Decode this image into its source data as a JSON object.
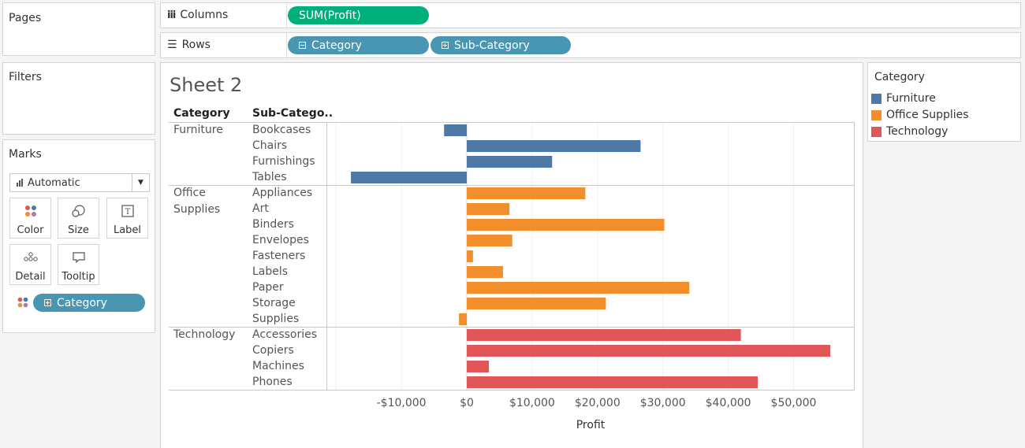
{
  "pages": {
    "title": "Pages"
  },
  "filters": {
    "title": "Filters"
  },
  "columns_shelf": {
    "label": "Columns",
    "pills": [
      "SUM(Profit)"
    ]
  },
  "rows_shelf": {
    "label": "Rows",
    "pills": [
      "Category",
      "Sub-Category"
    ]
  },
  "marks": {
    "title": "Marks",
    "type_value": "Automatic",
    "buttons": [
      "Color",
      "Size",
      "Label",
      "Detail",
      "Tooltip"
    ],
    "color_pill": "Category"
  },
  "sheet": {
    "title": "Sheet 2",
    "col_header_category": "Category",
    "col_header_subcategory": "Sub-Catego.."
  },
  "legend": {
    "title": "Category",
    "items": [
      {
        "label": "Furniture",
        "color": "#4e79a7"
      },
      {
        "label": "Office Supplies",
        "color": "#f28e2b"
      },
      {
        "label": "Technology",
        "color": "#e15759"
      }
    ]
  },
  "chart_data": {
    "type": "bar",
    "orientation": "horizontal",
    "xlabel": "Profit",
    "xlim": [
      -18000,
      59500
    ],
    "x_ticks": [
      "-$10,000",
      "$0",
      "$10,000",
      "$20,000",
      "$30,000",
      "$40,000",
      "$50,000"
    ],
    "groups": [
      {
        "category": "Furniture",
        "category_lines": [
          "Furniture"
        ],
        "color": "#4e79a7",
        "rows": [
          {
            "sub": "Bookcases",
            "value": -3473
          },
          {
            "sub": "Chairs",
            "value": 26590
          },
          {
            "sub": "Furnishings",
            "value": 13059
          },
          {
            "sub": "Tables",
            "value": -17725
          }
        ]
      },
      {
        "category": "Office Supplies",
        "category_lines": [
          "Office",
          "Supplies"
        ],
        "color": "#f28e2b",
        "rows": [
          {
            "sub": "Appliances",
            "value": 18138
          },
          {
            "sub": "Art",
            "value": 6528
          },
          {
            "sub": "Binders",
            "value": 30222
          },
          {
            "sub": "Envelopes",
            "value": 6964
          },
          {
            "sub": "Fasteners",
            "value": 950
          },
          {
            "sub": "Labels",
            "value": 5546
          },
          {
            "sub": "Paper",
            "value": 34054
          },
          {
            "sub": "Storage",
            "value": 21279
          },
          {
            "sub": "Supplies",
            "value": -1189
          }
        ]
      },
      {
        "category": "Technology",
        "category_lines": [
          "Technology"
        ],
        "color": "#e15759",
        "rows": [
          {
            "sub": "Accessories",
            "value": 41937
          },
          {
            "sub": "Copiers",
            "value": 55618
          },
          {
            "sub": "Machines",
            "value": 3385
          },
          {
            "sub": "Phones",
            "value": 44516
          }
        ]
      }
    ]
  }
}
